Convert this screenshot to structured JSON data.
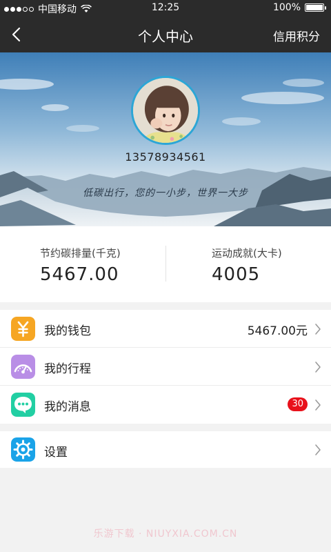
{
  "status_bar": {
    "carrier": "中国移动",
    "time": "12:25",
    "battery": "100%",
    "battery_level": 1.0,
    "signal_bars_filled": 3,
    "signal_bars_total": 5
  },
  "nav": {
    "title": "个人中心",
    "right_action": "信用积分",
    "back_icon": "chevron-left-icon"
  },
  "profile": {
    "phone": "13578934561",
    "slogan": "低碳出行，您的一小步，世界一大步"
  },
  "stats": [
    {
      "label": "节约碳排量(千克)",
      "value": "5467.00"
    },
    {
      "label": "运动成就(大卡)",
      "value": "4005"
    }
  ],
  "menu": [
    {
      "label": "我的钱包",
      "value": "5467.00元",
      "icon": "wallet-yen-icon",
      "color": "#f6a623"
    },
    {
      "label": "我的行程",
      "icon": "speedometer-icon",
      "color": "#b98ee6"
    },
    {
      "label": "我的消息",
      "badge": "30",
      "icon": "message-bubble-icon",
      "color": "#22cfa3"
    }
  ],
  "settings": {
    "label": "设置",
    "icon": "gear-icon",
    "color": "#1aa3e8"
  },
  "watermark": "乐游下载 · NIUYXIA.COM.CN",
  "colors": {
    "nav_bg": "#2b2b2b",
    "badge": "#e8111b",
    "avatar_ring": "#2ca6d6"
  }
}
